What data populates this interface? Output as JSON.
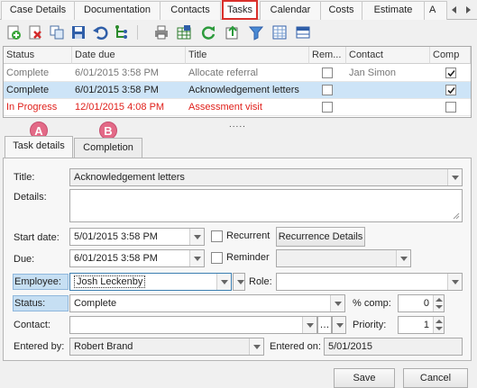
{
  "top_tabs": [
    "Case Details",
    "Documentation",
    "Contacts",
    "Tasks",
    "Calendar",
    "Costs",
    "Estimate",
    "A"
  ],
  "toolbar_icons": [
    "add-icon",
    "delete-icon",
    "copy-icon",
    "save-icon",
    "undo-icon",
    "tree-icon",
    "print-icon",
    "export-icon",
    "refresh-icon",
    "upload-icon",
    "filter-icon",
    "grid-icon",
    "columns-icon"
  ],
  "grid": {
    "headers": [
      "Status",
      "Date due",
      "Title",
      "Rem...",
      "Contact",
      "Comp"
    ],
    "rows": [
      {
        "status": "Complete",
        "date": "6/01/2015 3:58 PM",
        "title": "Allocate referral",
        "rem": false,
        "contact": "Jan Simon",
        "comp": true,
        "style": "grey"
      },
      {
        "status": "Complete",
        "date": "6/01/2015 3:58 PM",
        "title": "Acknowledgement letters",
        "rem": false,
        "contact": "",
        "comp": true,
        "style": "sel"
      },
      {
        "status": "In Progress",
        "date": "12/01/2015 4:08 PM",
        "title": "Assessment visit",
        "rem": false,
        "contact": "",
        "comp": false,
        "style": "red"
      }
    ],
    "splitter": "....."
  },
  "detail_tabs": [
    {
      "badge": "A",
      "label": "Task details"
    },
    {
      "badge": "B",
      "label": "Completion"
    }
  ],
  "form": {
    "title_label": "Title:",
    "title_value": "Acknowledgement letters",
    "details_label": "Details:",
    "details_value": "",
    "start_label": "Start date:",
    "start_value": "5/01/2015 3:58 PM",
    "recurrent_label": "Recurrent",
    "recurrence_button": "Recurrence Details",
    "due_label": "Due:",
    "due_value": "6/01/2015 3:58 PM",
    "reminder_label": "Reminder",
    "reminder_value": "",
    "employee_label": "Employee:",
    "employee_value": "Josh Leckenby",
    "role_label": "Role:",
    "role_value": "",
    "status_label": "Status:",
    "status_value": "Complete",
    "pct_label": "% comp:",
    "pct_value": "0",
    "contact_label": "Contact:",
    "contact_value": "",
    "contact_more": "…",
    "priority_label": "Priority:",
    "priority_value": "1",
    "entered_by_label": "Entered by:",
    "entered_by_value": "Robert Brand",
    "entered_on_label": "Entered on:",
    "entered_on_value": "5/01/2015"
  },
  "buttons": {
    "save": "Save",
    "cancel": "Cancel"
  },
  "colors": {
    "active_tab_border": "#d9302b",
    "selected_row": "#cde4f7",
    "in_progress": "#e0201b",
    "badge": "#e36a87"
  }
}
